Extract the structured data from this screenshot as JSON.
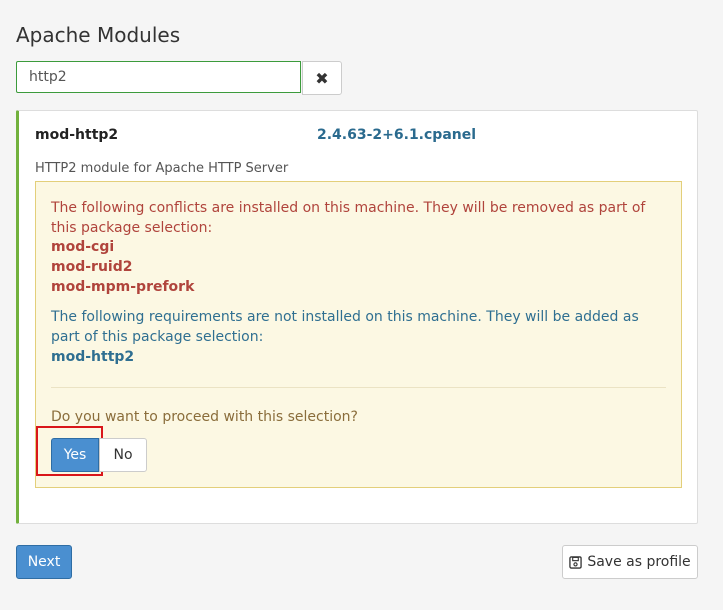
{
  "page": {
    "title": "Apache Modules"
  },
  "search": {
    "value": "http2",
    "clear_icon": "✖"
  },
  "package": {
    "name": "mod-http2",
    "version": "2.4.63-2+6.1.cpanel",
    "description": "HTTP2 module for Apache HTTP Server"
  },
  "alert": {
    "conflicts_text": "The following conflicts are installed on this machine. They will be removed as part of this package selection:",
    "conflicts": [
      "mod-cgi",
      "mod-ruid2",
      "mod-mpm-prefork"
    ],
    "requirements_text": "The following requirements are not installed on this machine. They will be added as part of this package selection:",
    "requirements": [
      "mod-http2"
    ],
    "question": "Do you want to proceed with this selection?",
    "yes_label": "Yes",
    "no_label": "No"
  },
  "footer": {
    "next_label": "Next",
    "save_label": "Save as profile"
  },
  "colors": {
    "accent": "#4a8fd0",
    "success_border": "#72b13d",
    "danger": "#b0443c",
    "info": "#2f6f91",
    "highlight": "#d9161a"
  }
}
